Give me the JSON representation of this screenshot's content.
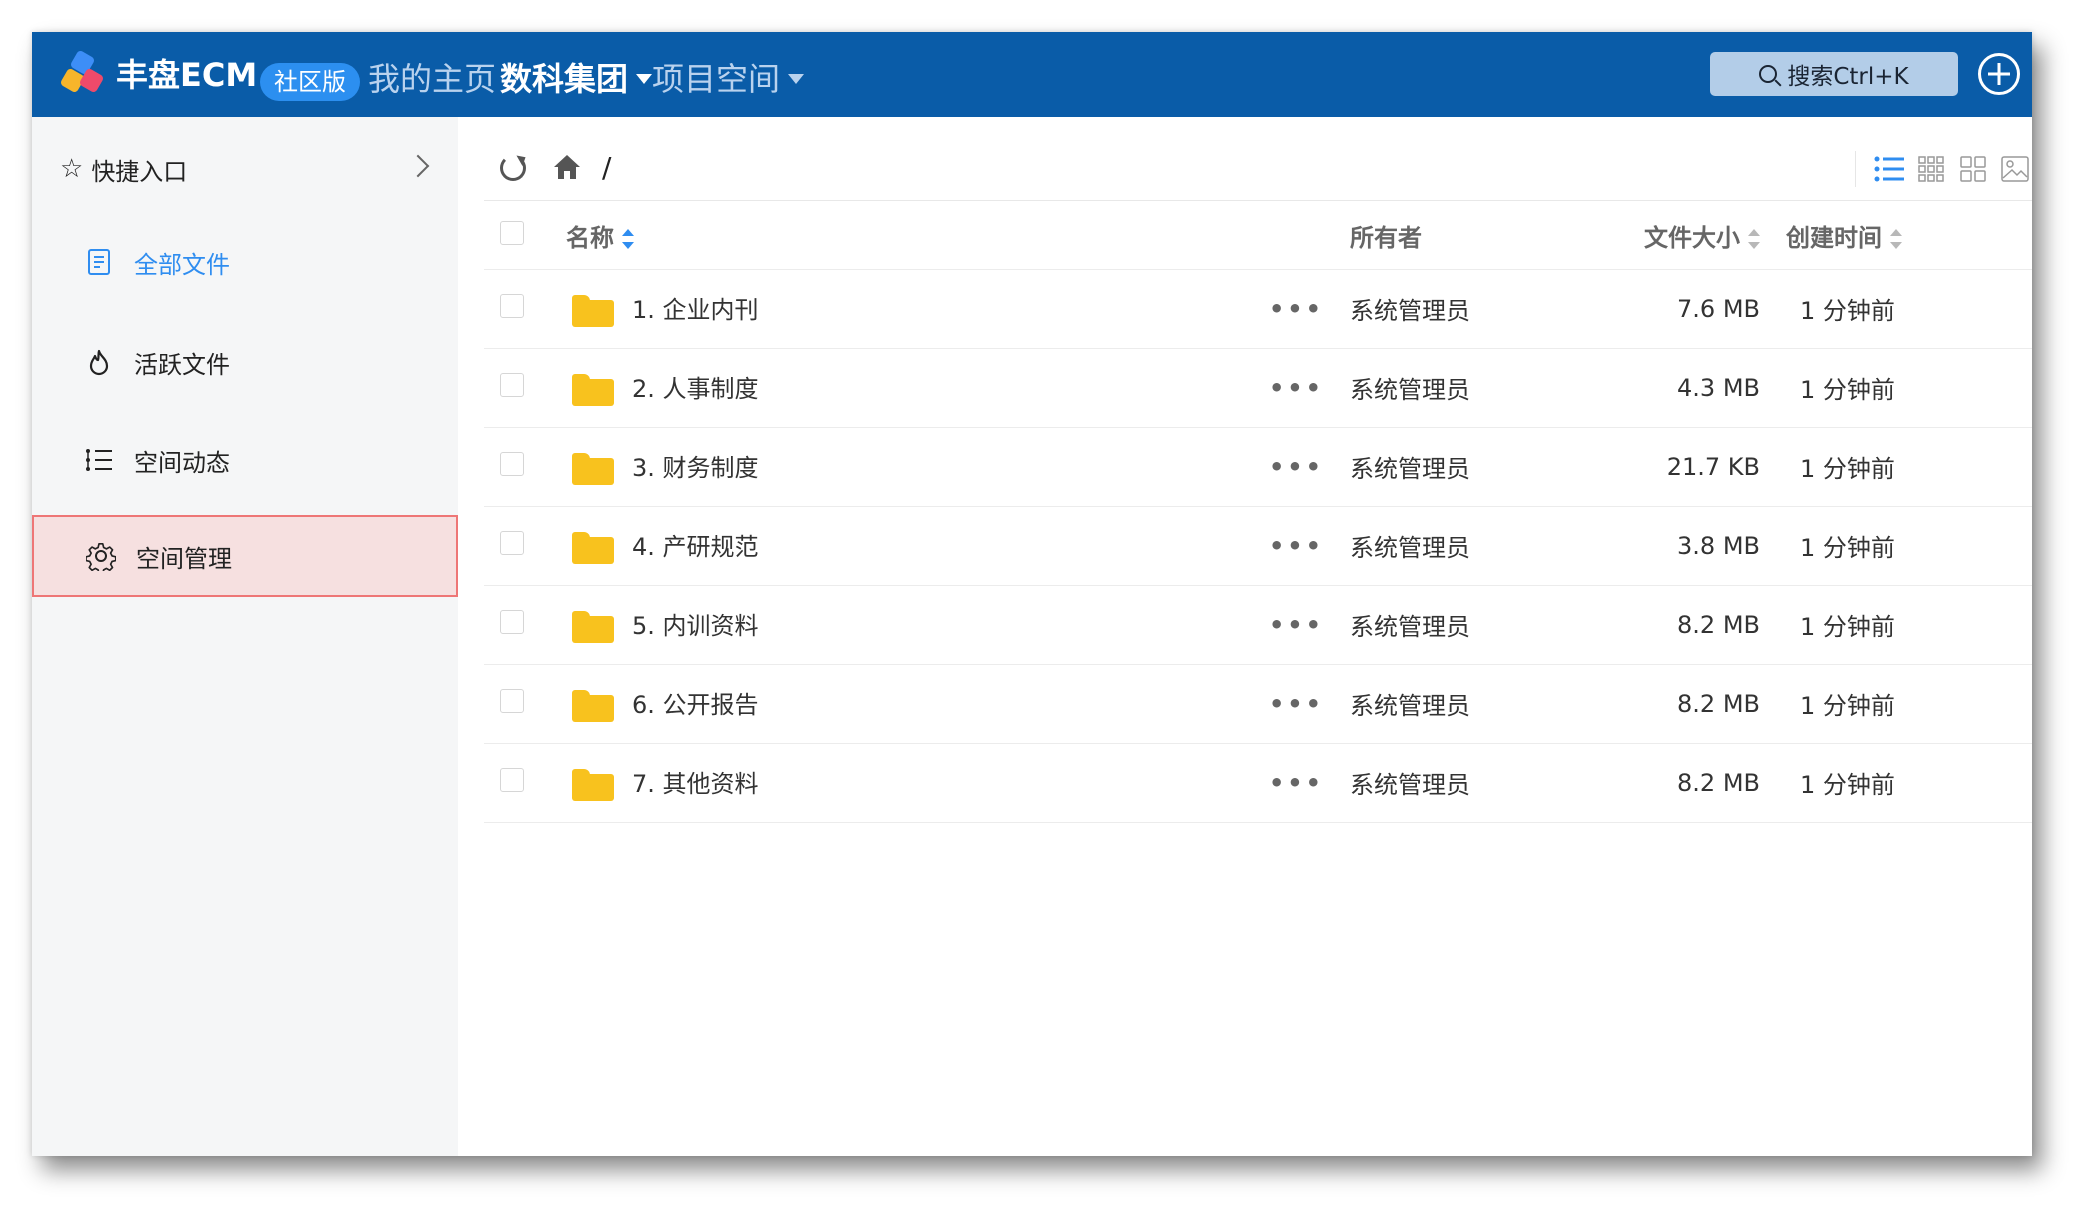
{
  "header": {
    "brand": "丰盘ECM",
    "edition": "社区版",
    "nav": [
      {
        "label": "我的主页",
        "active": false,
        "dropdown": false
      },
      {
        "label": "数科集团",
        "active": true,
        "dropdown": true
      },
      {
        "label": "项目空间",
        "active": false,
        "dropdown": true
      }
    ],
    "search_label": "搜索Ctrl+K"
  },
  "sidebar": {
    "quick_entry": "快捷入口",
    "items": [
      {
        "label": "全部文件",
        "icon": "document-icon",
        "state": "current"
      },
      {
        "label": "活跃文件",
        "icon": "flame-icon",
        "state": "normal"
      },
      {
        "label": "空间动态",
        "icon": "activity-list-icon",
        "state": "normal"
      },
      {
        "label": "空间管理",
        "icon": "gear-icon",
        "state": "selected"
      }
    ]
  },
  "toolbar": {
    "breadcrumb": "/"
  },
  "table": {
    "columns": {
      "name": "名称",
      "owner": "所有者",
      "size": "文件大小",
      "created": "创建时间"
    },
    "rows": [
      {
        "name": "1. 企业内刊",
        "owner": "系统管理员",
        "size": "7.6 MB",
        "created": "1 分钟前"
      },
      {
        "name": "2. 人事制度",
        "owner": "系统管理员",
        "size": "4.3 MB",
        "created": "1 分钟前"
      },
      {
        "name": "3. 财务制度",
        "owner": "系统管理员",
        "size": "21.7 KB",
        "created": "1 分钟前"
      },
      {
        "name": "4. 产研规范",
        "owner": "系统管理员",
        "size": "3.8 MB",
        "created": "1 分钟前"
      },
      {
        "name": "5. 内训资料",
        "owner": "系统管理员",
        "size": "8.2 MB",
        "created": "1 分钟前"
      },
      {
        "name": "6. 公开报告",
        "owner": "系统管理员",
        "size": "8.2 MB",
        "created": "1 分钟前"
      },
      {
        "name": "7. 其他资料",
        "owner": "系统管理员",
        "size": "8.2 MB",
        "created": "1 分钟前"
      }
    ],
    "more_label": "•••"
  },
  "colors": {
    "header_bg": "#0a5ca8",
    "accent": "#2f8df0",
    "folder": "#f8c21e",
    "selected_bg": "#f6e0e0",
    "selected_border": "#ee7676"
  }
}
